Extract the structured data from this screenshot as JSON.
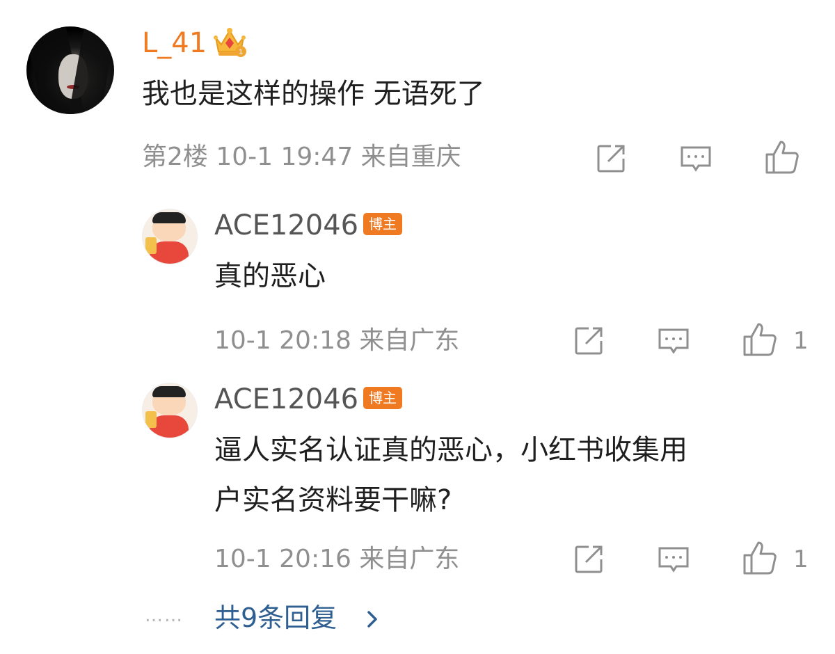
{
  "main_comment": {
    "username": "L_41",
    "content": "我也是这样的操作 无语死了",
    "meta": "第2楼 10-1 19:47 来自重庆",
    "icons": {
      "vip": "crown-icon",
      "share": "share-icon",
      "comment": "comment-icon",
      "like": "like-icon"
    }
  },
  "replies": [
    {
      "username": "ACE12046",
      "badge": "博主",
      "content_lines": [
        "真的恶心"
      ],
      "meta": "10-1 20:18 来自广东",
      "like_count": "1"
    },
    {
      "username": "ACE12046",
      "badge": "博主",
      "content_lines": [
        "逼人实名认证真的恶心，小红书收集用",
        "户实名资料要干嘛?"
      ],
      "meta": "10-1 20:16 来自广东",
      "like_count": "1"
    }
  ],
  "footer": {
    "dots": "……",
    "more_replies": "共9条回复",
    "chevron_icon": "chevron-right-icon"
  },
  "colors": {
    "username_orange": "#ef7a22",
    "badge_orange": "#f07a22",
    "link_blue": "#2f5f91",
    "meta_gray": "#8f8f8f"
  }
}
